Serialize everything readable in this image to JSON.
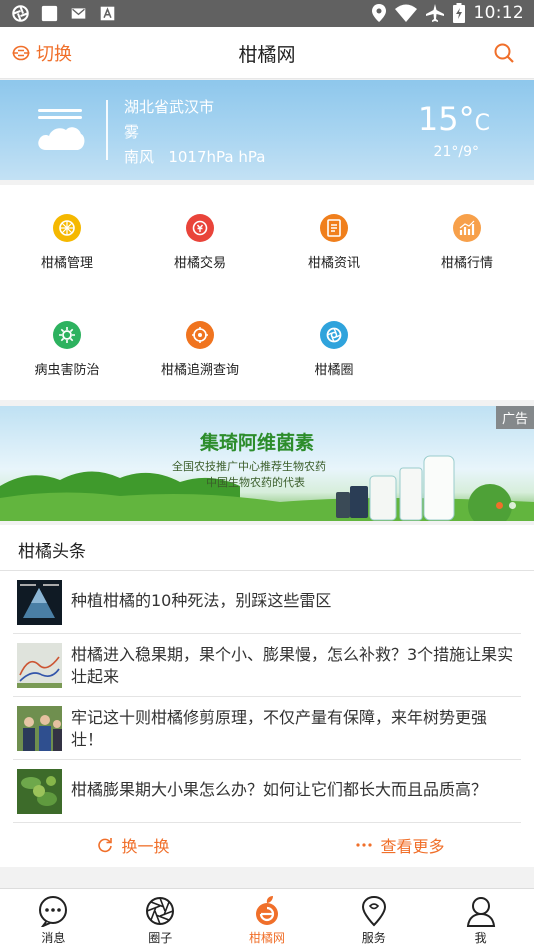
{
  "status_bar": {
    "time": "10:12",
    "icons": [
      "aperture-icon",
      "square-icon",
      "mail-icon",
      "font-icon",
      "location-icon",
      "wifi-icon",
      "airplane-icon",
      "battery-icon"
    ]
  },
  "header": {
    "switch_label": "切换",
    "title": "柑橘网"
  },
  "weather": {
    "city": "湖北省武汉市",
    "condition": "雾",
    "wind": "南风",
    "pressure": "1017hPa hPa",
    "temperature": "15°",
    "unit": "C",
    "range": "21°/9°"
  },
  "features": [
    {
      "label": "柑橘管理",
      "color": "#f5b800"
    },
    {
      "label": "柑橘交易",
      "color": "#e9443a"
    },
    {
      "label": "柑橘资讯",
      "color": "#f07f1c"
    },
    {
      "label": "柑橘行情",
      "color": "#f7a04a"
    },
    {
      "label": "病虫害防治",
      "color": "#2db25f"
    },
    {
      "label": "柑橘追溯查询",
      "color": "#f0741f"
    },
    {
      "label": "柑橘圈",
      "color": "#2fa3dc"
    }
  ],
  "banner": {
    "ad_label": "广告",
    "brand": "集琦阿维菌素",
    "slogan1": "全国农技推广中心推荐生物农药",
    "slogan2": "中国生物农药的代表"
  },
  "news": {
    "section_title": "柑橘头条",
    "items": [
      {
        "title": "种植柑橘的10种死法，别踩这些雷区"
      },
      {
        "title": "柑橘进入稳果期，果个小、膨果慢，怎么补救？3个措施让果实壮起来"
      },
      {
        "title": "牢记这十则柑橘修剪原理，不仅产量有保障，来年树势更强壮！"
      },
      {
        "title": "柑橘膨果期大小果怎么办？如何让它们都长大而且品质高？"
      }
    ],
    "refresh_label": "换一换",
    "more_label": "查看更多"
  },
  "tabs": [
    {
      "label": "消息",
      "icon": "chat-icon"
    },
    {
      "label": "圈子",
      "icon": "aperture-icon"
    },
    {
      "label": "柑橘网",
      "icon": "orange-icon",
      "active": true
    },
    {
      "label": "服务",
      "icon": "location-pin-icon"
    },
    {
      "label": "我",
      "icon": "user-icon"
    }
  ],
  "colors": {
    "accent": "#f06f2a"
  }
}
